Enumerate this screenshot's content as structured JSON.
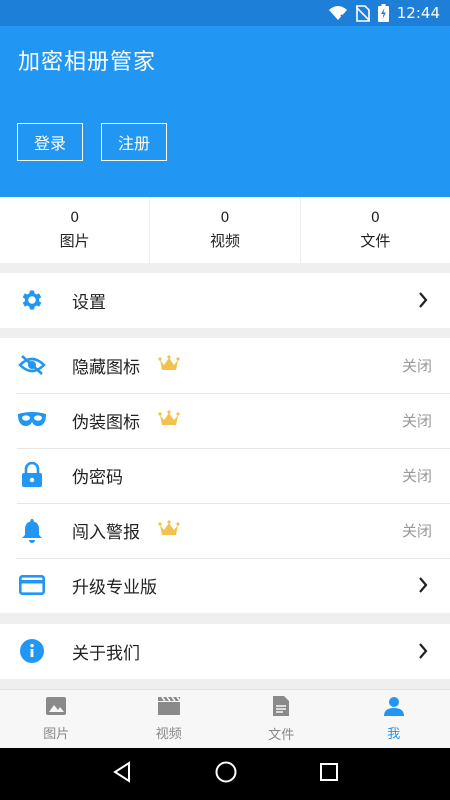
{
  "statusbar": {
    "time": "12:44"
  },
  "header": {
    "title": "加密相册管家",
    "login_label": "登录",
    "register_label": "注册"
  },
  "stats": [
    {
      "count": "0",
      "label": "图片"
    },
    {
      "count": "0",
      "label": "视频"
    },
    {
      "count": "0",
      "label": "文件"
    }
  ],
  "menu": {
    "settings": "设置",
    "hide_icon": {
      "label": "隐藏图标",
      "status": "关闭"
    },
    "disguise_icon": {
      "label": "伪装图标",
      "status": "关闭"
    },
    "fake_password": {
      "label": "伪密码",
      "status": "关闭"
    },
    "intrusion_alert": {
      "label": "闯入警报",
      "status": "关闭"
    },
    "upgrade": "升级专业版",
    "about": "关于我们"
  },
  "tabs": [
    {
      "label": "图片"
    },
    {
      "label": "视频"
    },
    {
      "label": "文件"
    },
    {
      "label": "我"
    }
  ],
  "colors": {
    "primary": "#2196f3",
    "statusbar": "#1e7fd8",
    "crown": "#f2c14e",
    "muted": "#999999"
  }
}
